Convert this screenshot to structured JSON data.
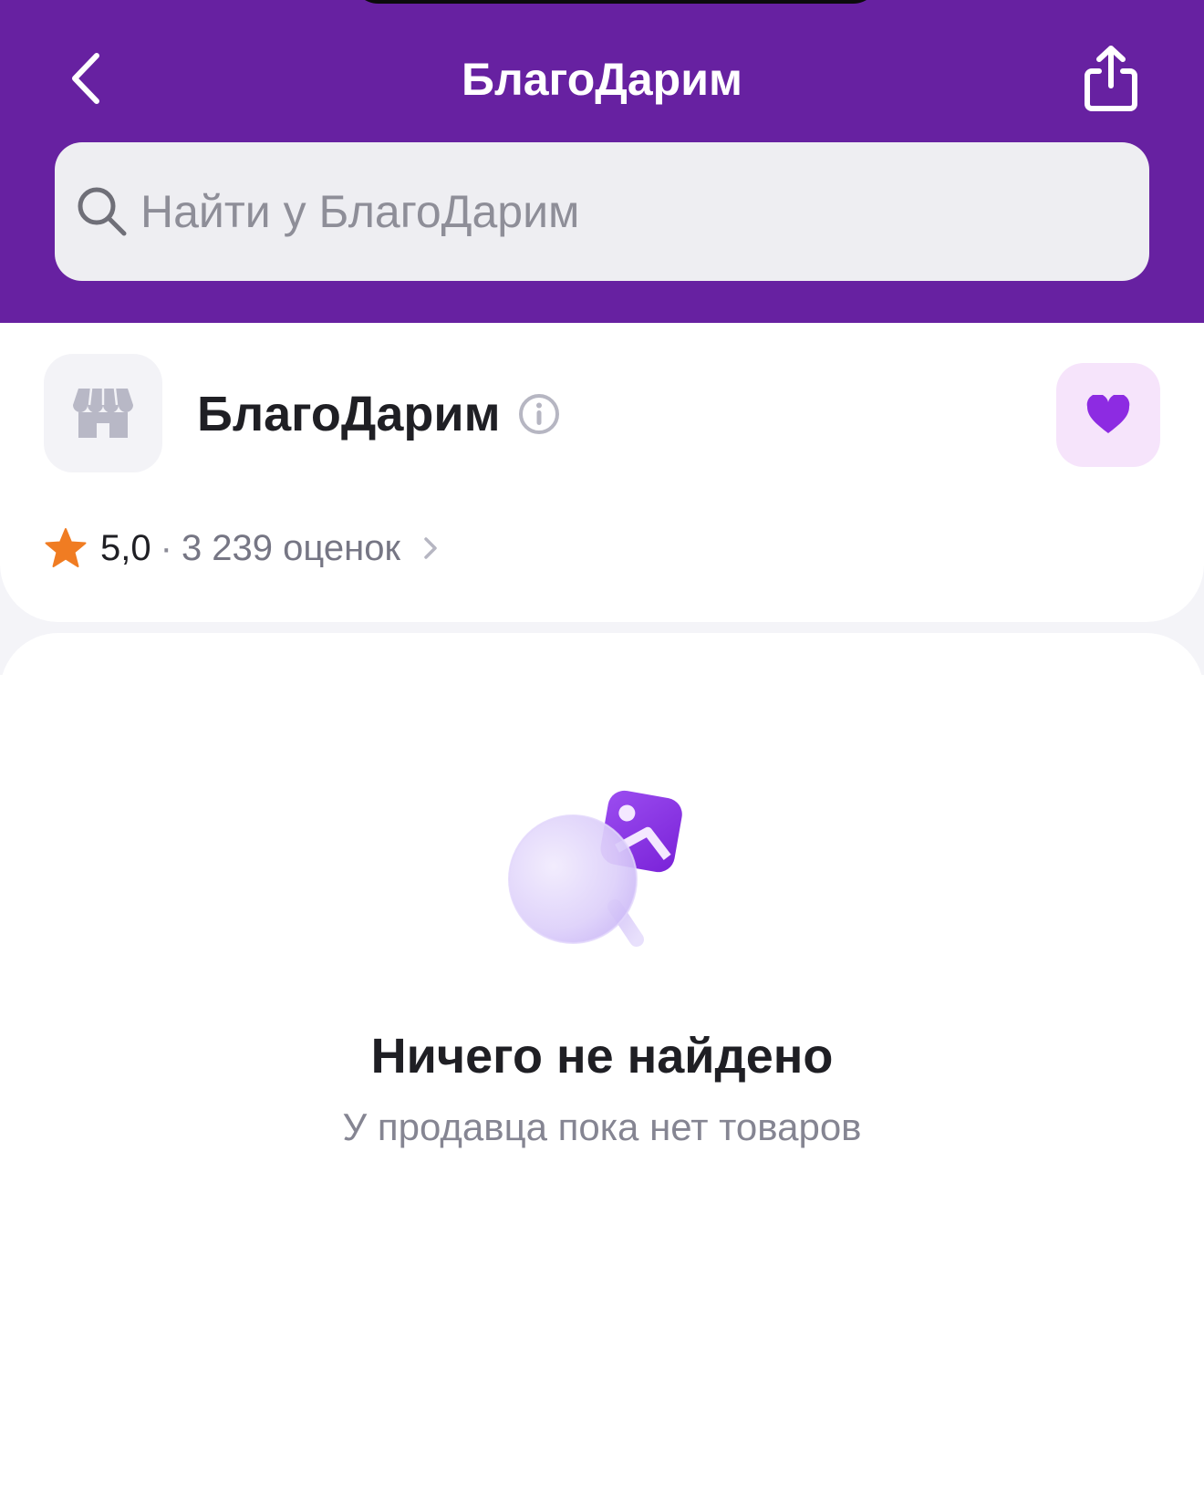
{
  "header": {
    "title": "БлагоДарим",
    "back_icon": "chevron-left-icon",
    "share_icon": "share-icon",
    "background_color": "#6721a1"
  },
  "search": {
    "placeholder": "Найти у БлагоДарим",
    "value": "",
    "icon": "search-icon"
  },
  "store": {
    "name": "БлагоДарим",
    "logo_icon": "storefront-icon",
    "info_icon": "info-icon",
    "favorite_icon": "heart-icon",
    "favorite_color": "#8d2be2",
    "favorited": true
  },
  "rating": {
    "icon": "star-icon",
    "star_color": "#f07c22",
    "value": "5,0",
    "separator": "·",
    "count_label": "3 239 оценок"
  },
  "empty_state": {
    "illustration": "magnifier-image-icon",
    "title": "Ничего не найдено",
    "subtitle": "У продавца пока нет товаров"
  }
}
